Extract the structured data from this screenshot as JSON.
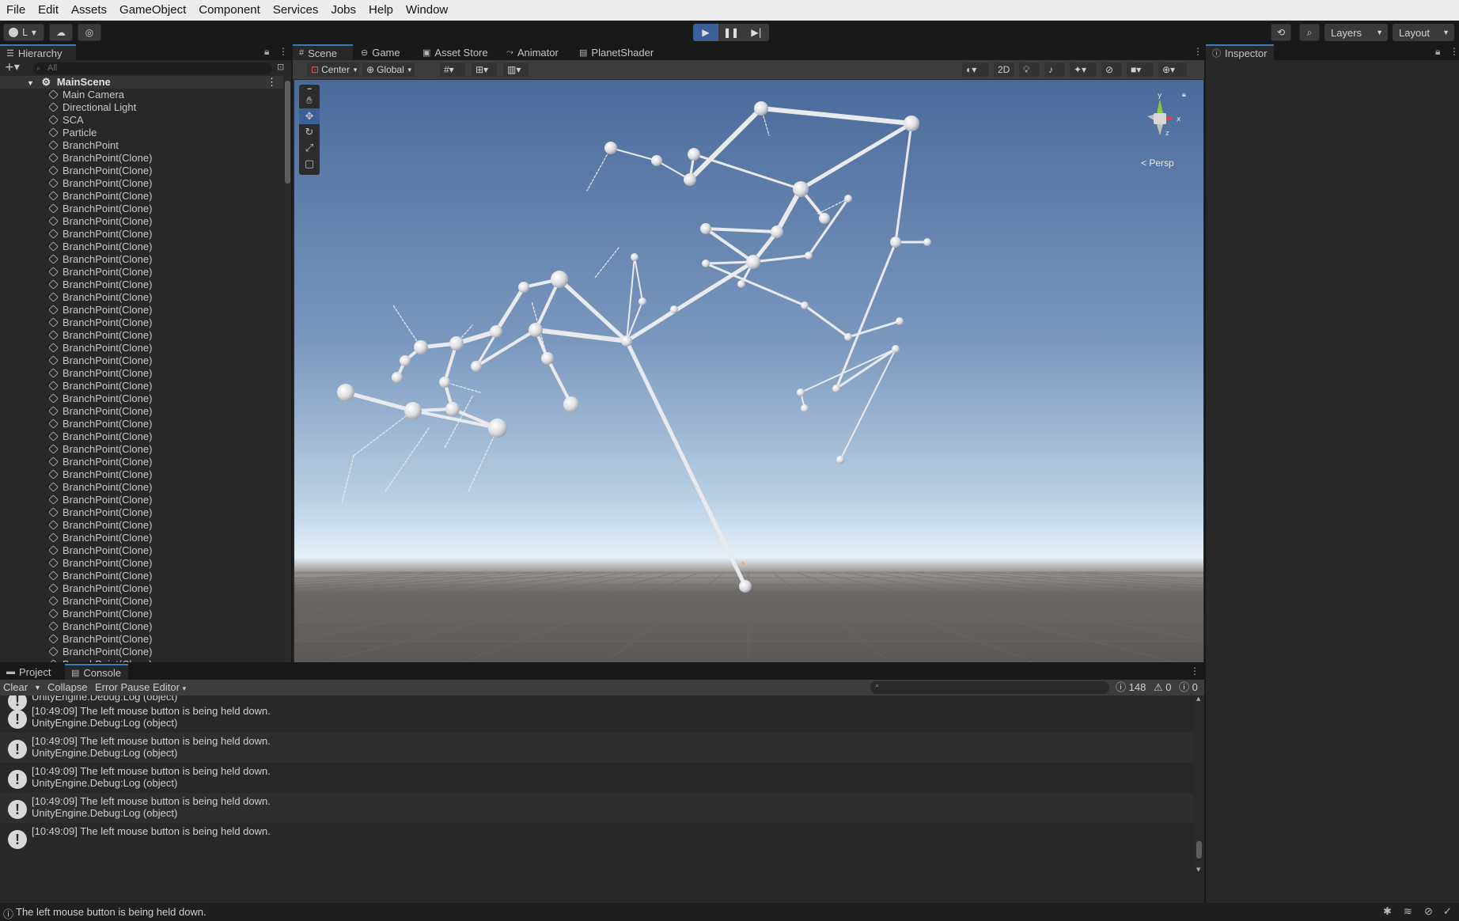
{
  "menu": [
    "File",
    "Edit",
    "Assets",
    "GameObject",
    "Component",
    "Services",
    "Jobs",
    "Help",
    "Window"
  ],
  "toolbar": {
    "account_label": "L",
    "play_icon": "play-icon",
    "pause_icon": "pause-icon",
    "step_icon": "step-icon",
    "layers_label": "Layers",
    "layout_label": "Layout"
  },
  "hierarchy": {
    "tab_label": "Hierarchy",
    "search_placeholder": "All",
    "scene_name": "MainScene",
    "items": [
      "Main Camera",
      "Directional Light",
      "SCA",
      "Particle",
      "BranchPoint",
      "BranchPoint(Clone)",
      "BranchPoint(Clone)",
      "BranchPoint(Clone)",
      "BranchPoint(Clone)",
      "BranchPoint(Clone)",
      "BranchPoint(Clone)",
      "BranchPoint(Clone)",
      "BranchPoint(Clone)",
      "BranchPoint(Clone)",
      "BranchPoint(Clone)",
      "BranchPoint(Clone)",
      "BranchPoint(Clone)",
      "BranchPoint(Clone)",
      "BranchPoint(Clone)",
      "BranchPoint(Clone)",
      "BranchPoint(Clone)",
      "BranchPoint(Clone)",
      "BranchPoint(Clone)",
      "BranchPoint(Clone)",
      "BranchPoint(Clone)",
      "BranchPoint(Clone)",
      "BranchPoint(Clone)",
      "BranchPoint(Clone)",
      "BranchPoint(Clone)",
      "BranchPoint(Clone)",
      "BranchPoint(Clone)",
      "BranchPoint(Clone)",
      "BranchPoint(Clone)",
      "BranchPoint(Clone)",
      "BranchPoint(Clone)",
      "BranchPoint(Clone)",
      "BranchPoint(Clone)",
      "BranchPoint(Clone)",
      "BranchPoint(Clone)",
      "BranchPoint(Clone)",
      "BranchPoint(Clone)",
      "BranchPoint(Clone)",
      "BranchPoint(Clone)",
      "BranchPoint(Clone)",
      "BranchPoint(Clone)",
      "BranchPoint(Clone)"
    ]
  },
  "scene": {
    "tabs": [
      {
        "label": "Scene",
        "icon": "grid-icon"
      },
      {
        "label": "Game",
        "icon": "gamepad-icon"
      },
      {
        "label": "Asset Store",
        "icon": "store-icon"
      },
      {
        "label": "Animator",
        "icon": "animator-icon"
      },
      {
        "label": "PlanetShader",
        "icon": "shader-icon"
      }
    ],
    "pivot_label": "Center",
    "space_label": "Global",
    "mode_2d_label": "2D",
    "persp_label": "Persp",
    "gizmo_axes": {
      "y": "y",
      "x": "x",
      "z": "z"
    },
    "tools": [
      "hand-icon",
      "move-icon",
      "rotate-icon",
      "scale-icon",
      "rect-icon",
      "transform-icon"
    ]
  },
  "inspector": {
    "tab_label": "Inspector"
  },
  "console": {
    "tabs": [
      {
        "label": "Project",
        "icon": "folder-icon"
      },
      {
        "label": "Console",
        "icon": "console-icon"
      }
    ],
    "clear_label": "Clear",
    "collapse_label": "Collapse",
    "error_pause_label": "Error Pause",
    "editor_label": "Editor",
    "log_count": "148",
    "warning_count": "0",
    "error_count": "0",
    "partial_top_line": "UnityEngine.Debug:Log (object)",
    "entries": [
      {
        "line1": "[10:49:09] The left mouse button is being held down.",
        "line2": "UnityEngine.Debug:Log (object)"
      },
      {
        "line1": "[10:49:09] The left mouse button is being held down.",
        "line2": "UnityEngine.Debug:Log (object)"
      },
      {
        "line1": "[10:49:09] The left mouse button is being held down.",
        "line2": "UnityEngine.Debug:Log (object)"
      },
      {
        "line1": "[10:49:09] The left mouse button is being held down.",
        "line2": "UnityEngine.Debug:Log (object)"
      },
      {
        "line1": "[10:49:09] The left mouse button is being held down.",
        "line2": ""
      }
    ]
  },
  "statusbar": {
    "message": "The left mouse button is being held down."
  },
  "colors": {
    "accent": "#3a79bb",
    "play_active": "#3b5f99",
    "sky_top": "#4a6a9a",
    "sky_horizon": "#e6f0f7",
    "ground": "#5b5856"
  }
}
